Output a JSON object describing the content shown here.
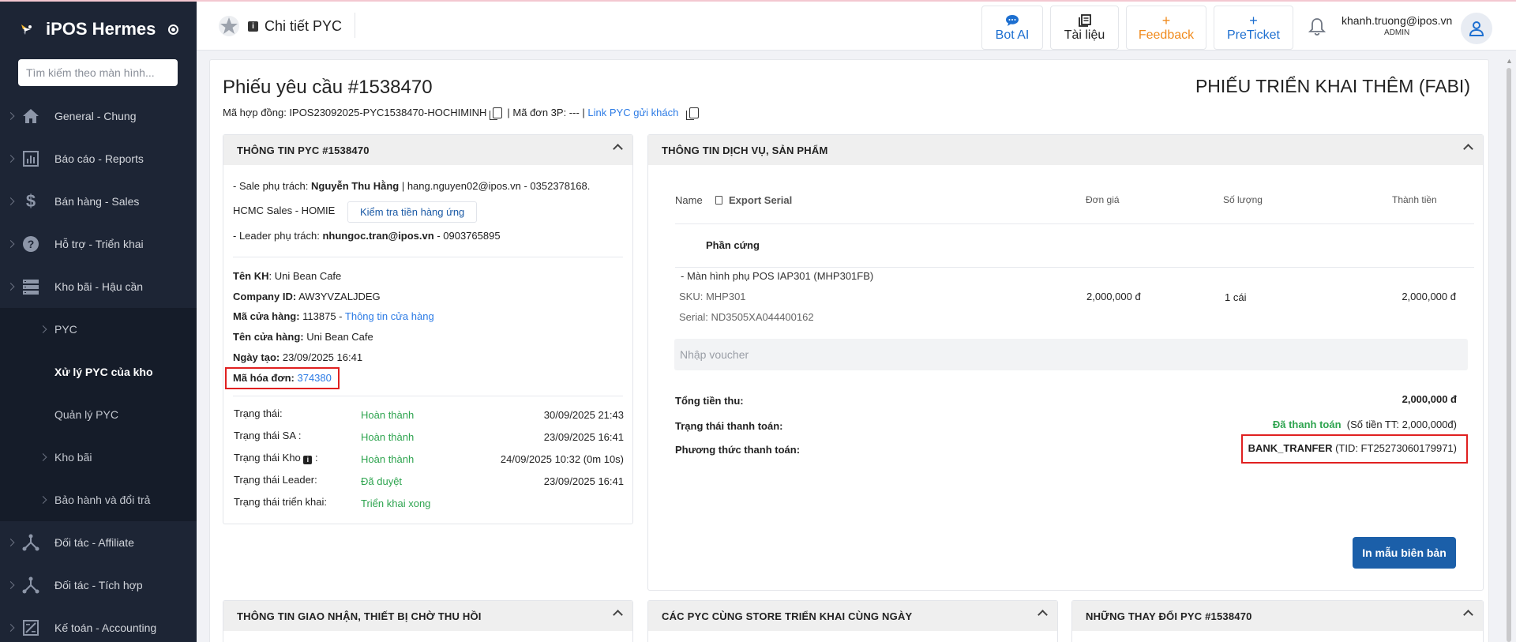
{
  "app": {
    "name": "iPOS Hermes"
  },
  "sidebar": {
    "search_placeholder": "Tìm kiếm theo màn hình...",
    "items": [
      {
        "label": "General - Chung",
        "icon": "home-icon"
      },
      {
        "label": "Báo cáo - Reports",
        "icon": "bar-chart-icon"
      },
      {
        "label": "Bán hàng - Sales",
        "icon": "dollar-icon"
      },
      {
        "label": "Hỗ trợ - Triển khai",
        "icon": "help-icon"
      },
      {
        "label": "Kho bãi - Hậu cần",
        "icon": "storage-icon"
      }
    ],
    "subitems": [
      {
        "label": "PYC"
      },
      {
        "label": "Xử lý PYC của kho"
      },
      {
        "label": "Quản lý PYC"
      },
      {
        "label": "Kho bãi"
      },
      {
        "label": "Bảo hành và đổi trả"
      }
    ],
    "items_after": [
      {
        "label": "Đối tác - Affiliate",
        "icon": "network-icon"
      },
      {
        "label": "Đối tác - Tích hợp",
        "icon": "network-icon"
      },
      {
        "label": "Kế toán - Accounting",
        "icon": "accounting-icon"
      }
    ]
  },
  "header": {
    "title": "Chi tiết PYC",
    "info_glyph": "i",
    "buttons": {
      "bot": "Bot AI",
      "docs": "Tài liệu",
      "feedback": "Feedback",
      "preticket": "PreTicket",
      "plus_glyph": "+"
    },
    "user_email": "khanh.truong@ipos.vn",
    "user_role": "ADMIN"
  },
  "request": {
    "title": "Phiếu yêu cầu #1538470",
    "type": "PHIẾU TRIỂN KHAI THÊM (FABI)",
    "contract_prefix": "Mã hợp đồng: IPOS23092025-PYC1538470-HOCHIMINH",
    "order3p": "| Mã đơn 3P: --- |",
    "link_label": "Link PYC gửi khách"
  },
  "info_panel": {
    "title": "THÔNG TIN PYC #1538470",
    "sale_prefix": "- Sale phụ trách: ",
    "sale_name": "Nguyễn Thu Hằng",
    "sale_contact": " | hang.nguyen02@ipos.vn - 0352378168.",
    "sale_team": "HCMC Sales - HOMIE",
    "check_button": "Kiểm tra tiền hàng ứng",
    "leader_prefix": "- Leader phụ trách: ",
    "leader_email": "nhungoc.tran@ipos.vn",
    "leader_phone": " - 0903765895",
    "customer_label": "Tên KH",
    "customer_value": ": Uni Bean Cafe",
    "company_label": "Company ID:",
    "company_value": " AW3YVZALJDEG",
    "store_code_label": "Mã cửa hàng:",
    "store_code_value": " 113875 - ",
    "store_info_link": "Thông tin cửa hàng",
    "store_name_label": "Tên cửa hàng:",
    "store_name_value": " Uni Bean Cafe",
    "created_label": "Ngày tạo:",
    "created_value": " 23/09/2025 16:41",
    "invoice_label": "Mã hóa đơn:",
    "invoice_value": "374380",
    "statuses": [
      {
        "label": "Trạng thái:",
        "value": "Hoàn thành",
        "date": "30/09/2025 21:43"
      },
      {
        "label": "Trạng thái SA :",
        "value": "Hoàn thành",
        "date": "23/09/2025 16:41"
      },
      {
        "label": "Trạng thái Kho",
        "value": "Hoàn thành",
        "date": "24/09/2025 10:32 (0m 10s)"
      },
      {
        "label": "Trạng thái Leader:",
        "value": "Đã duyệt",
        "date": "23/09/2025 16:41"
      },
      {
        "label": "Trạng thái triển khai:",
        "value": "Triển khai xong",
        "date": ""
      }
    ],
    "kho_suffix": " :"
  },
  "service_panel": {
    "title": "THÔNG TIN DỊCH VỤ, SẢN PHẨM",
    "columns": {
      "name": "Name",
      "export": "Export Serial",
      "price": "Đơn giá",
      "qty": "Số lượng",
      "total": "Thành tiền"
    },
    "group": "Phần cứng",
    "item": {
      "name": "- Màn hình phụ POS IAP301 (MHP301FB)",
      "sku": "SKU: MHP301",
      "serial": "Serial: ND3505XA044400162",
      "price": "2,000,000 đ",
      "qty": "1 cái",
      "total": "2,000,000 đ"
    },
    "voucher_placeholder": "Nhập voucher",
    "total_label": "Tổng tiền thu:",
    "total_value": "2,000,000 đ",
    "pay_status_label": "Trạng thái thanh toán:",
    "pay_status_value": "Đã thanh toán",
    "pay_status_amount": "(Số tiền TT: 2,000,000đ)",
    "pay_method_label": "Phương thức thanh toán:",
    "pay_method_value": "BANK_TRANFER",
    "pay_method_tid": " (TID: FT25273060179971)",
    "print_button": "In mẫu biên bản"
  },
  "bottom_panels": {
    "delivery": "THÔNG TIN GIAO NHẬN, THIẾT BỊ CHỜ THU HỒI",
    "same_store": "CÁC PYC CÙNG STORE TRIỂN KHAI CÙNG NGÀY",
    "changes": "NHỮNG THAY ĐỔI PYC #1538470"
  },
  "colors": {
    "sidebar_bg": "#1d2535",
    "accent_blue": "#2c7be5",
    "status_green": "#2ea44f",
    "print_button": "#1b5fa9",
    "highlight_red": "#e02020",
    "feedback_orange": "#f08a1c"
  }
}
